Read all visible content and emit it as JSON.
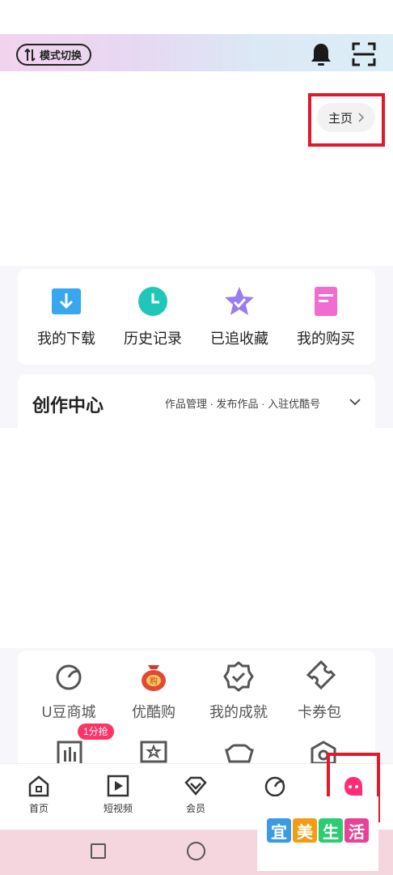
{
  "header": {
    "mode_switch_label": "模式切换",
    "icons": [
      "bell-icon",
      "scan-icon"
    ]
  },
  "profile": {
    "home_button_label": "主页"
  },
  "quick_actions": [
    {
      "label": "我的下载",
      "icon": "download-icon",
      "color": "#38a7ef"
    },
    {
      "label": "历史记录",
      "icon": "clock-icon",
      "color": "#20c7b8"
    },
    {
      "label": "已追收藏",
      "icon": "star-icon",
      "color": "#9b7cf0"
    },
    {
      "label": "我的购买",
      "icon": "purchase-icon",
      "color": "#f06ccf"
    }
  ],
  "creation_center": {
    "title": "创作中心",
    "links": "作品管理 · 发布作品 · 入驻优酷号"
  },
  "services": [
    {
      "label": "U豆商城",
      "icon": "udou-icon"
    },
    {
      "label": "优酷购",
      "icon": "shopping-bag-icon"
    },
    {
      "label": "我的成就",
      "icon": "achievement-icon"
    },
    {
      "label": "卡券包",
      "icon": "coupon-icon"
    }
  ],
  "services_row2_badge": "1分抢",
  "tabs": [
    {
      "label": "首页",
      "icon": "home-icon"
    },
    {
      "label": "短视频",
      "icon": "short-video-icon"
    },
    {
      "label": "会员",
      "icon": "vip-icon"
    },
    {
      "label": "",
      "icon": "discover-icon"
    },
    {
      "label": "",
      "icon": "profile-icon"
    }
  ],
  "watermark": [
    "宜",
    "美",
    "生",
    "活"
  ],
  "colors": {
    "accent": "#ff3366",
    "highlight_box": "#e0192b"
  }
}
